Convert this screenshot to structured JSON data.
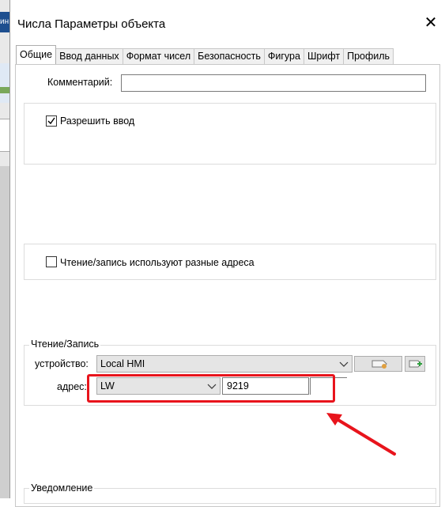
{
  "dialog": {
    "title": "Числа Параметры объекта",
    "close_glyph": "✕"
  },
  "tabs": [
    {
      "label": "Общие",
      "active": true
    },
    {
      "label": "Ввод данных",
      "active": false
    },
    {
      "label": "Формат чисел",
      "active": false
    },
    {
      "label": "Безопасность",
      "active": false
    },
    {
      "label": "Фигура",
      "active": false
    },
    {
      "label": "Шрифт",
      "active": false
    },
    {
      "label": "Профиль",
      "active": false
    }
  ],
  "general": {
    "comment_label": "Комментарий:",
    "comment_value": "",
    "allow_input_label": "Разрешить ввод",
    "allow_input_checked": true,
    "separate_rw_label": "Чтение/запись используют разные адреса",
    "separate_rw_checked": false
  },
  "read_write": {
    "group_title": "Чтение/Запись",
    "device_label": "устройство:",
    "device_value": "Local HMI",
    "address_label": "адрес:",
    "address_type": "LW",
    "address_value": "9219"
  },
  "notification": {
    "group_title": "Уведомление"
  },
  "icons": {
    "device_settings": "tag-icon",
    "device_add": "add-device-icon",
    "dropdown": "chevron-down-icon",
    "checkbox_mark": "checkmark-icon"
  },
  "colors": {
    "highlight": "#e8141c",
    "combo_bg": "#e5e5e5",
    "border": "#adadad"
  }
}
